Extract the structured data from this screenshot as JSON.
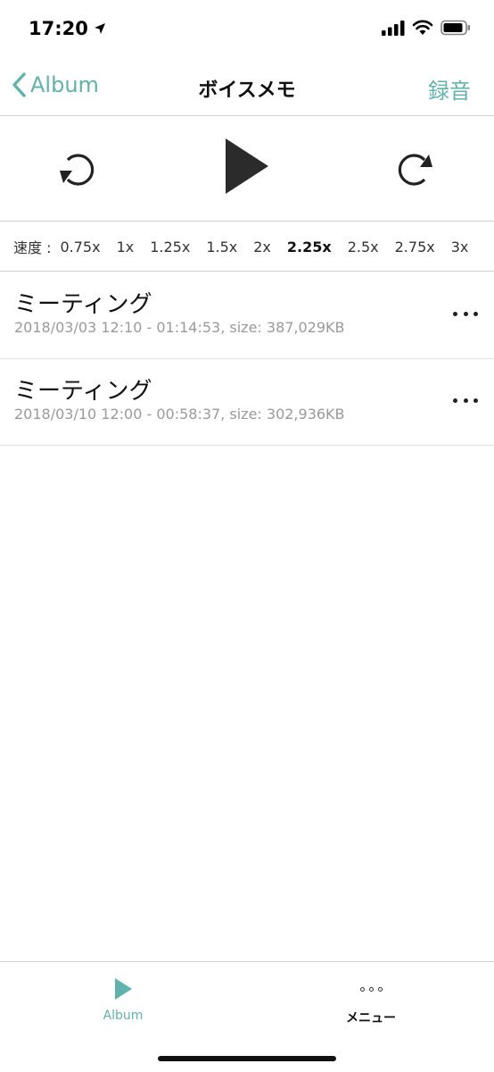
{
  "status": {
    "time": "17:20"
  },
  "nav": {
    "back_label": "Album",
    "title": "ボイスメモ",
    "record_label": "録音"
  },
  "speed": {
    "label": "速度 :",
    "options": [
      "0.75x",
      "1x",
      "1.25x",
      "1.5x",
      "2x",
      "2.25x",
      "2.5x",
      "2.75x",
      "3x"
    ],
    "selected": "2.25x"
  },
  "recordings": [
    {
      "title": "ミーティング",
      "meta": "2018/03/03 12:10 - 01:14:53, size: 387,029KB"
    },
    {
      "title": "ミーティング",
      "meta": "2018/03/10 12:00 - 00:58:37, size: 302,936KB"
    }
  ],
  "tabs": {
    "album_label": "Album",
    "menu_label": "メニュー"
  },
  "colors": {
    "accent": "#5fb3ad",
    "text": "#111111",
    "meta": "#9a9a9a"
  },
  "icons": {
    "back": "chevron-left-icon",
    "rewind": "rotate-ccw-icon",
    "play": "play-icon",
    "forward": "rotate-cw-icon",
    "more": "more-horizontal-icon"
  }
}
